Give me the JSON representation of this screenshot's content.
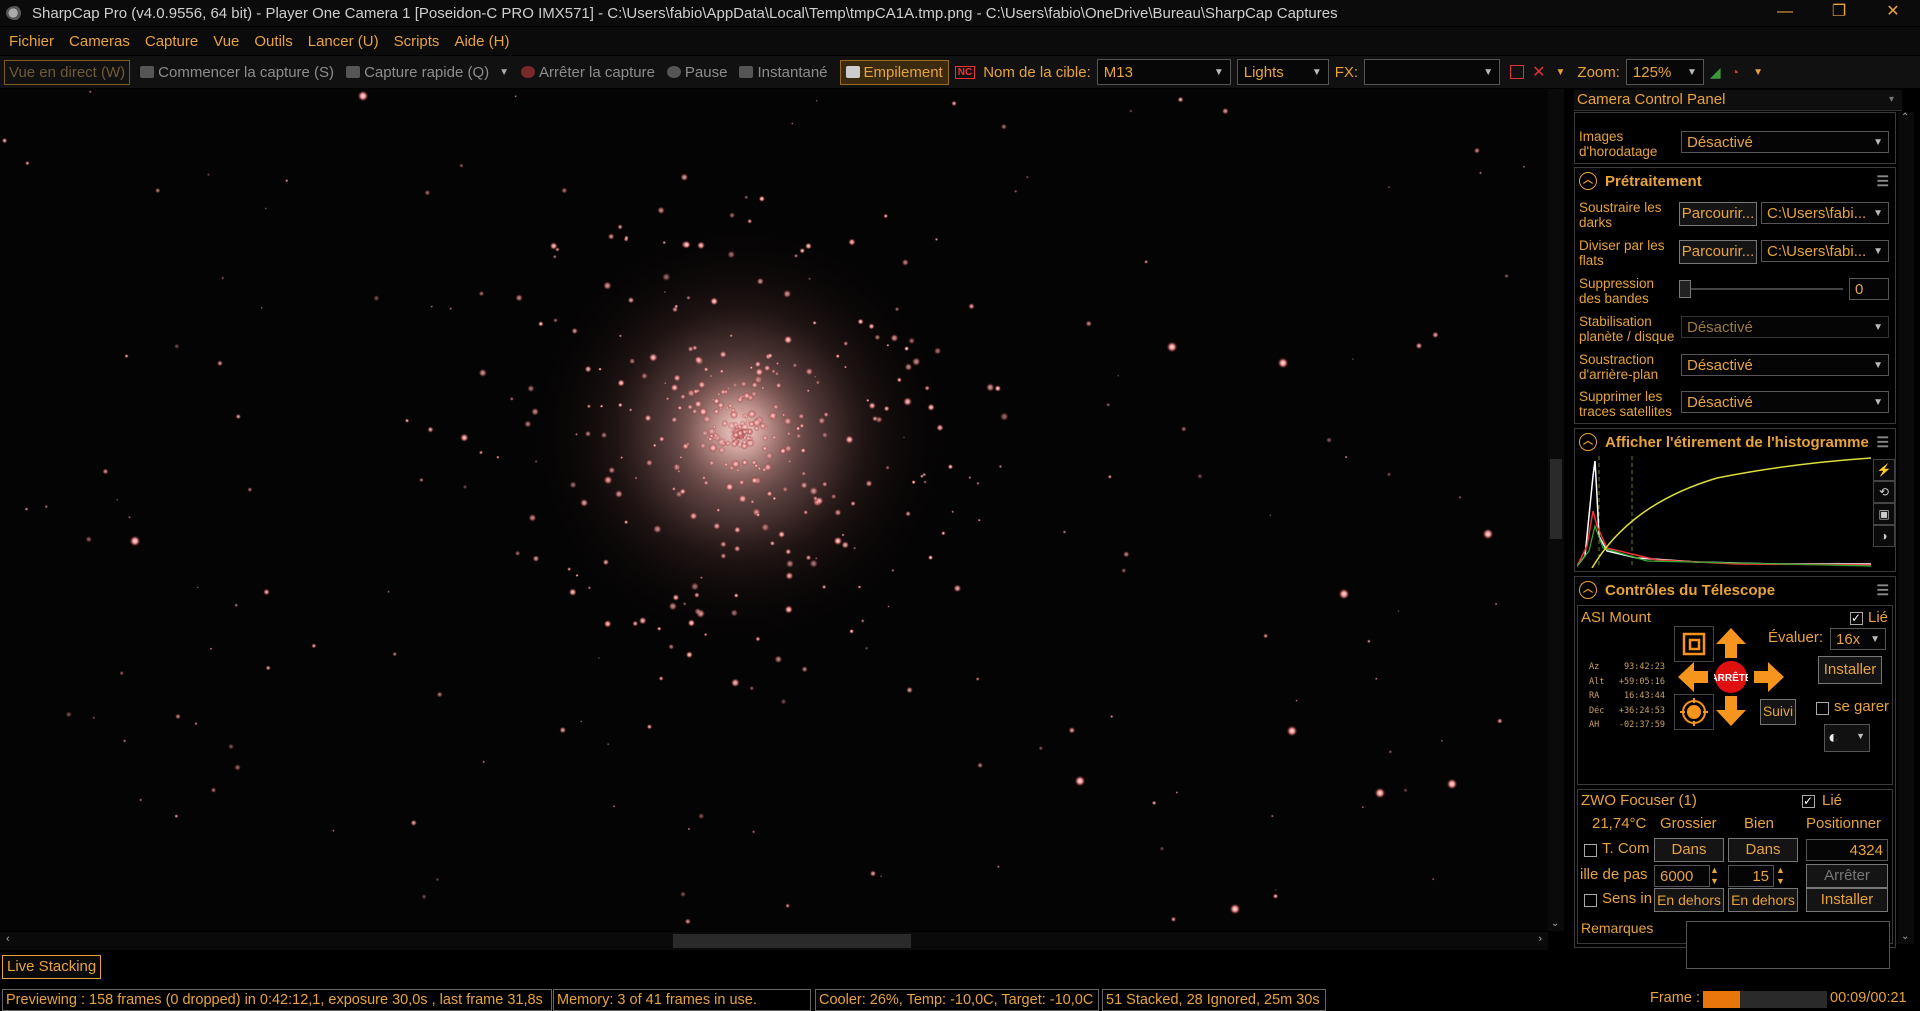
{
  "window": {
    "title": "SharpCap Pro (v4.0.9556, 64 bit) - Player One Camera 1 [Poseidon-C PRO IMX571] - C:\\Users\\fabio\\AppData\\Local\\Temp\\tmpCA1A.tmp.png - C:\\Users\\fabio\\OneDrive\\Bureau\\SharpCap Captures",
    "minimize": "—",
    "restore": "❐",
    "close": "✕"
  },
  "menu": [
    "Fichier",
    "Cameras",
    "Capture",
    "Vue",
    "Outils",
    "Lancer (U)",
    "Scripts",
    "Aide (H)"
  ],
  "toolbar": {
    "live_view": "Vue en direct (W)",
    "start_capture": "Commencer la capture (S)",
    "quick_capture": "Capture rapide (Q)",
    "stop_capture": "Arrêter la capture",
    "pause": "Pause",
    "snapshot": "Instantané",
    "stacking": "Empilement",
    "nc_badge": "NC",
    "target_label": "Nom de la cible:",
    "target_value": "M13",
    "frame_type": "Lights",
    "fx_label": "FX:",
    "fx_value": "",
    "zoom_label": "Zoom:",
    "zoom_value": "125%"
  },
  "live_stacking_tab": "Live Stacking",
  "status": {
    "previewing": "Previewing : 158 frames (0 dropped) in 0:42:12,1, exposure 30,0s , last frame 31,8s",
    "memory": "Memory: 3 of 41 frames in use.",
    "cooler": "Cooler: 26%, Temp: -10,0C, Target: -10,0C",
    "stacked": "51 Stacked, 28 Ignored, 25m 30s",
    "frame_label": "Frame :",
    "frame_progress": 0.3,
    "time": "00:09/00:21"
  },
  "panel": {
    "title": "Camera Control Panel",
    "timestamp": {
      "label1": "Images",
      "label2": "d'horodatage",
      "value": "Désactivé"
    },
    "preprocessing": {
      "header": "Prétraitement",
      "darks": {
        "label1": "Soustraire les",
        "label2": "darks",
        "button": "Parcourir...",
        "path": "C:\\Users\\fabi..."
      },
      "flats": {
        "label1": "Diviser par les",
        "label2": "flats",
        "button": "Parcourir...",
        "path": "C:\\Users\\fabi..."
      },
      "banding": {
        "label1": "Suppression",
        "label2": "des bandes",
        "value": "0"
      },
      "stabilisation": {
        "label1": "Stabilisation",
        "label2": "planète / disque",
        "value": "Désactivé"
      },
      "background": {
        "label1": "Soustraction",
        "label2": "d'arrière-plan",
        "value": "Désactivé"
      },
      "satellites": {
        "label1": "Supprimer les",
        "label2": "traces satellites",
        "value": "Désactivé"
      }
    },
    "histogram": {
      "header": "Afficher l'étirement de l'histogramme"
    },
    "telescope": {
      "header": "Contrôles du Télescope",
      "mount": "ASI Mount",
      "linked": "Lié",
      "rate_label": "Évaluer:",
      "rate_value": "16x",
      "install": "Installer",
      "stop": "ARRÊTE",
      "park": "se garer",
      "tracking": "Suivi",
      "coords": [
        {
          "k": "Az",
          "v": "93:42:23"
        },
        {
          "k": "Alt",
          "v": "+59:05:16"
        },
        {
          "k": "RA",
          "v": "16:43:44"
        },
        {
          "k": "Déc",
          "v": "+36:24:53"
        },
        {
          "k": "AH",
          "v": "-02:37:59"
        }
      ]
    },
    "focuser": {
      "name": "ZWO Focuser (1)",
      "linked": "Lié",
      "temperature": "21,74°C",
      "coarse": "Grossier",
      "fine": "Bien",
      "position_label": "Positionner",
      "tcomp": "T. Com",
      "in1": "Dans",
      "in2": "Dans",
      "position": "4324",
      "step_label": "ille de pas",
      "step_coarse": "6000",
      "step_fine": "15",
      "stop": "Arrêter",
      "reverse": "Sens in",
      "out1": "En dehors",
      "out2": "En dehors",
      "install": "Installer"
    },
    "notes": {
      "label": "Remarques"
    }
  },
  "colors": {
    "accent": "#e8a33c",
    "background": "#000000"
  }
}
